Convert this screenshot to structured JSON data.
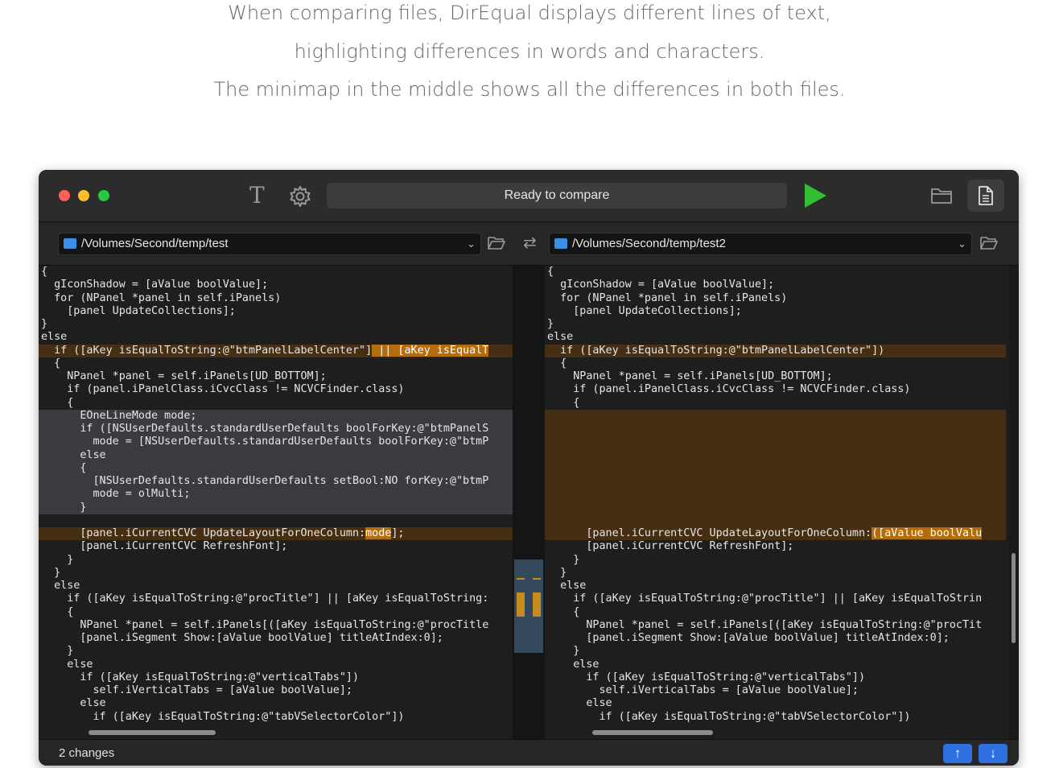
{
  "caption": {
    "line1": "When comparing files, DirEqual displays different lines of text,",
    "line2": "highlighting differences in words and characters.",
    "line3": "The minimap in the middle shows all the differences in both files."
  },
  "toolbar": {
    "text_mode_label": "T",
    "status": "Ready to compare"
  },
  "paths": {
    "left": "/Volumes/Second/temp/test",
    "right": "/Volumes/Second/temp/test2",
    "swap_label": "⇄"
  },
  "left_code": {
    "l1": "{",
    "l2": "  gIconShadow = [aValue boolValue];",
    "l3": "  for (NPanel *panel in self.iPanels)",
    "l4": "    [panel UpdateCollections];",
    "l5": "}",
    "l6": "else",
    "l7a": "  if ([aKey isEqualToString:@\"btmPanelLabelCenter\"]",
    "l7b": " || [aKey isEqualT",
    "l8": "  {",
    "l9": "    NPanel *panel = self.iPanels[UD_BOTTOM];",
    "l10": "    if (panel.iPanelClass.iCvcClass != NCVCFinder.class)",
    "l11": "    {",
    "l12": "      EOneLineMode mode;",
    "l13": "      if ([NSUserDefaults.standardUserDefaults boolForKey:@\"btmPanelS",
    "l14": "        mode = [NSUserDefaults.standardUserDefaults boolForKey:@\"btmP",
    "l15": "      else",
    "l16": "      {",
    "l17": "        [NSUserDefaults.standardUserDefaults setBool:NO forKey:@\"btmP",
    "l18": "        mode = olMulti;",
    "l19": "      }",
    "l20": "",
    "l21a": "      [panel.iCurrentCVC UpdateLayoutForOneColumn:",
    "l21b": "mode",
    "l21c": "];",
    "l22": "      [panel.iCurrentCVC RefreshFont];",
    "l23": "    }",
    "l24": "  }",
    "l25": "  else",
    "l26": "    if ([aKey isEqualToString:@\"procTitle\"] || [aKey isEqualToString:",
    "l27": "    {",
    "l28": "      NPanel *panel = self.iPanels[([aKey isEqualToString:@\"procTitle",
    "l29": "      [panel.iSegment Show:[aValue boolValue] titleAtIndex:0];",
    "l30": "    }",
    "l31": "    else",
    "l32": "      if ([aKey isEqualToString:@\"verticalTabs\"])",
    "l33": "        self.iVerticalTabs = [aValue boolValue];",
    "l34": "      else",
    "l35": "        if ([aKey isEqualToString:@\"tabVSelectorColor\"])"
  },
  "right_code": {
    "l1": "{",
    "l2": "  gIconShadow = [aValue boolValue];",
    "l3": "  for (NPanel *panel in self.iPanels)",
    "l4": "    [panel UpdateCollections];",
    "l5": "}",
    "l6": "else",
    "l7": "  if ([aKey isEqualToString:@\"btmPanelLabelCenter\"])",
    "l8": "  {",
    "l9": "    NPanel *panel = self.iPanels[UD_BOTTOM];",
    "l10": "    if (panel.iPanelClass.iCvcClass != NCVCFinder.class)",
    "l11": "    {",
    "l21a": "      [panel.iCurrentCVC UpdateLayoutForOneColumn:",
    "l21b": "([aValue boolValu",
    "l22": "      [panel.iCurrentCVC RefreshFont];",
    "l23": "    }",
    "l24": "  }",
    "l25": "  else",
    "l26": "    if ([aKey isEqualToString:@\"procTitle\"] || [aKey isEqualToStrin",
    "l27": "    {",
    "l28": "      NPanel *panel = self.iPanels[([aKey isEqualToString:@\"procTit",
    "l29": "      [panel.iSegment Show:[aValue boolValue] titleAtIndex:0];",
    "l30": "    }",
    "l31": "    else",
    "l32": "      if ([aKey isEqualToString:@\"verticalTabs\"])",
    "l33": "        self.iVerticalTabs = [aValue boolValue];",
    "l34": "      else",
    "l35": "        if ([aKey isEqualToString:@\"tabVSelectorColor\"])"
  },
  "footer": {
    "changes": "2 changes",
    "up_label": "↑",
    "down_label": "↓"
  },
  "colors": {
    "diff_line": "#452e12",
    "diff_word": "#b56d0c",
    "removed_block": "#3c3a40",
    "minimap_viewport": "#34495c",
    "accent": "#2f6fe0",
    "play": "#30c030"
  },
  "icons": [
    "text-mode-icon",
    "gear-icon",
    "play-icon",
    "folder-icon",
    "document-icon",
    "swap-icon",
    "open-folder-icon",
    "arrow-up-icon",
    "arrow-down-icon"
  ]
}
